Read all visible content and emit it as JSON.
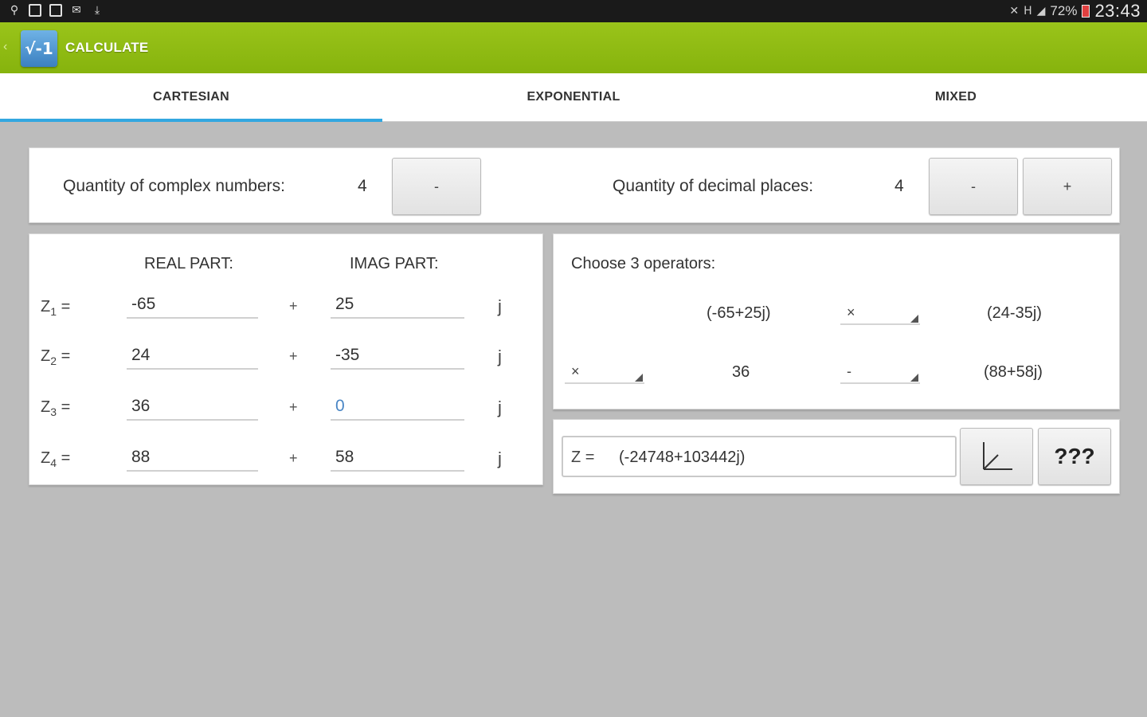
{
  "status_bar": {
    "left_icons": [
      "usb-icon",
      "sd-card-icon",
      "image-icon",
      "email-icon",
      "download-icon"
    ],
    "network": "H",
    "battery": "72%",
    "time": "23:43"
  },
  "action_bar": {
    "logo_text": "√-1",
    "title": "CALCULATE"
  },
  "tabs": [
    {
      "label": "CARTESIAN",
      "active": true
    },
    {
      "label": "EXPONENTIAL",
      "active": false
    },
    {
      "label": "MIXED",
      "active": false
    }
  ],
  "settings": {
    "complex_label": "Quantity of complex numbers:",
    "complex_value": "4",
    "complex_minus": "-",
    "decimal_label": "Quantity of decimal places:",
    "decimal_value": "4",
    "decimal_minus": "-",
    "decimal_plus": "+"
  },
  "inputs": {
    "real_header": "REAL PART:",
    "imag_header": "IMAG PART:",
    "plus_sign": "+",
    "j_sign": "j",
    "rows": [
      {
        "z": "Z",
        "sub": "1",
        "eq": "=",
        "real": "-65",
        "imag": "25"
      },
      {
        "z": "Z",
        "sub": "2",
        "eq": "=",
        "real": "24",
        "imag": "-35"
      },
      {
        "z": "Z",
        "sub": "3",
        "eq": "=",
        "real": "36",
        "imag": "0"
      },
      {
        "z": "Z",
        "sub": "4",
        "eq": "=",
        "real": "88",
        "imag": "58"
      }
    ]
  },
  "operators": {
    "title": "Choose 3 operators:",
    "row1_left": "(-65+25j)",
    "row1_op": "×",
    "row1_right": "(24-35j)",
    "row2_op1": "×",
    "row2_mid": "36",
    "row2_op2": "-",
    "row2_right": "(88+58j)"
  },
  "result": {
    "z_label": "Z =",
    "value": "(-24748+103442j)",
    "plot_icon": "axes-plot-icon",
    "unknown_button": "???"
  }
}
